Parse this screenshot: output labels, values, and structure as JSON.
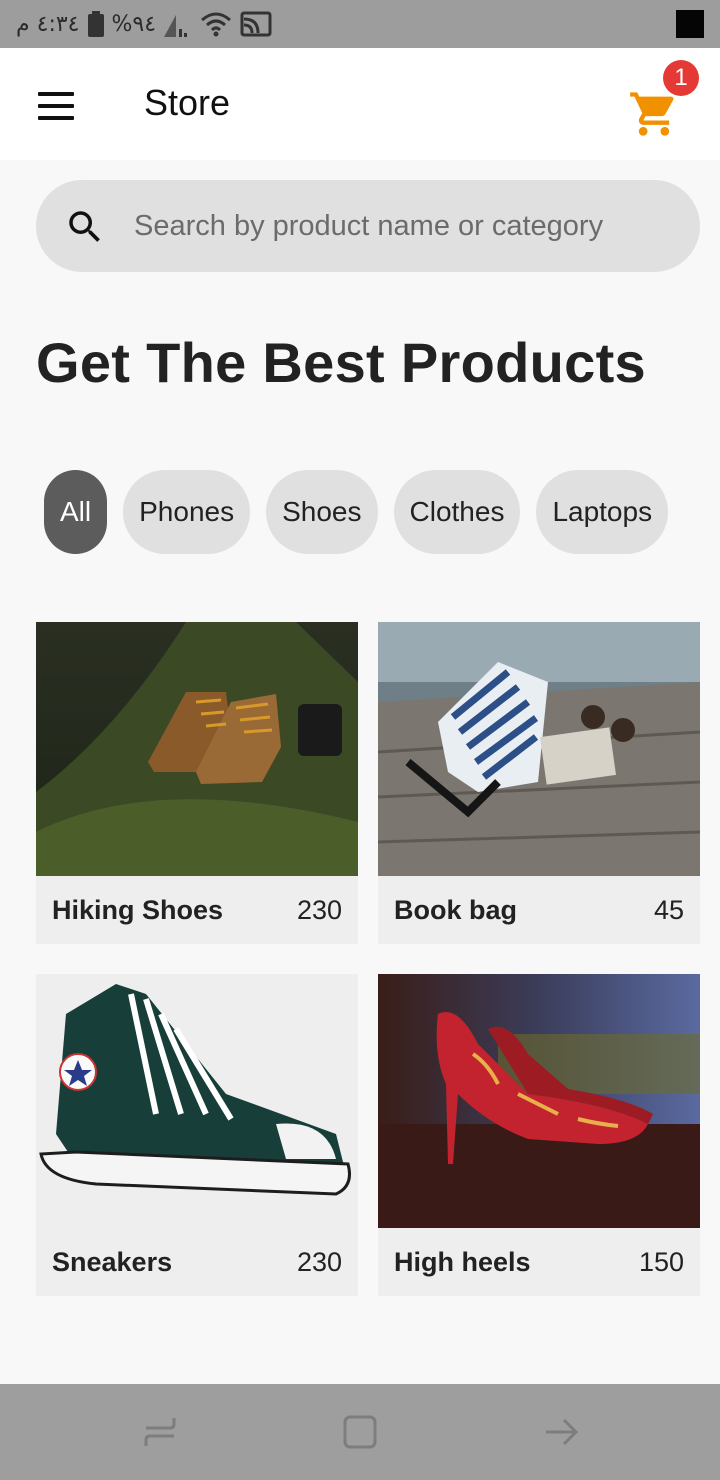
{
  "status_bar": {
    "time": "٤:٣٤ م",
    "battery": "%٩٤"
  },
  "app_bar": {
    "title": "Store",
    "cart_count": "1"
  },
  "search": {
    "placeholder": "Search by product name or category"
  },
  "headline": "Get The Best Products",
  "categories": [
    {
      "label": "All",
      "selected": true
    },
    {
      "label": "Phones",
      "selected": false
    },
    {
      "label": "Shoes",
      "selected": false
    },
    {
      "label": "Clothes",
      "selected": false
    },
    {
      "label": "Laptops",
      "selected": false
    }
  ],
  "products": [
    {
      "name": "Hiking Shoes",
      "price": "230"
    },
    {
      "name": "Book bag",
      "price": "45"
    },
    {
      "name": "Sneakers",
      "price": "230"
    },
    {
      "name": "High heels",
      "price": "150"
    }
  ],
  "colors": {
    "accent_cart": "#f29100",
    "badge": "#e53935",
    "chip_selected": "#5c5c5c",
    "chip": "#e0e0e0"
  }
}
